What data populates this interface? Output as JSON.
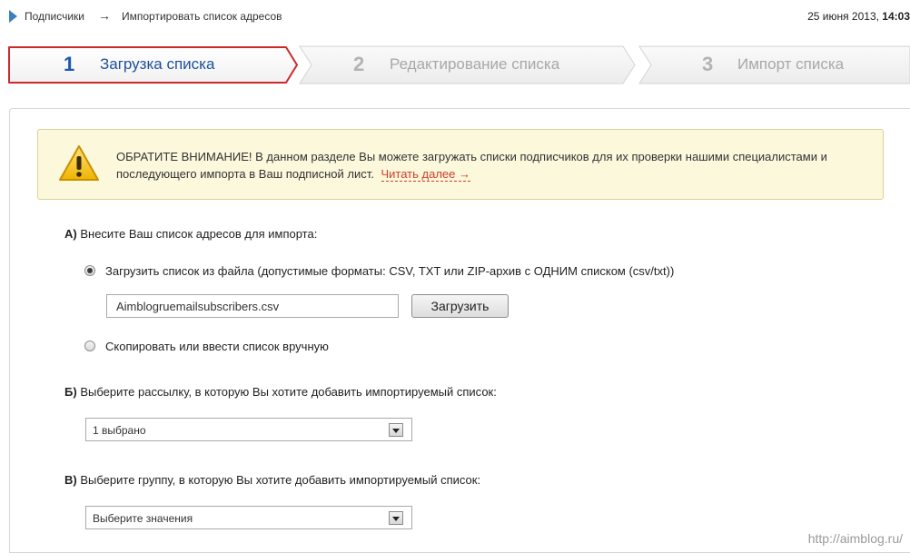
{
  "breadcrumb": {
    "item1": "Подписчики",
    "separator": "→",
    "item2": "Импортировать список адресов"
  },
  "datetime": {
    "date": "25 июня 2013,",
    "time": "14:03"
  },
  "steps": [
    {
      "num": "1",
      "label": "Загрузка списка",
      "active": true
    },
    {
      "num": "2",
      "label": "Редактирование списка",
      "active": false
    },
    {
      "num": "3",
      "label": "Импорт списка",
      "active": false
    }
  ],
  "notice": {
    "text": "ОБРАТИТЕ ВНИМАНИЕ! В данном разделе Вы можете загружать списки подписчиков для их проверки нашими специалистами и последующего импорта в Ваш подписной лист.",
    "link": "Читать далее →"
  },
  "sectionA": {
    "letter": "А)",
    "label": "Внесите Ваш список адресов для импорта:",
    "option_file": "Загрузить список из файла (допустимые форматы: CSV, TXT или ZIP-архив с ОДНИМ списком (csv/txt))",
    "file_value": "Aimblogruemailsubscribers.csv",
    "upload_button": "Загрузить",
    "option_manual": "Скопировать или ввести список вручную"
  },
  "sectionB": {
    "letter": "Б)",
    "label": "Выберите рассылку, в которую Вы хотите добавить импортируемый список:",
    "select_value": "1 выбрано"
  },
  "sectionC": {
    "letter": "В)",
    "label": "Выберите группу, в которую Вы хотите добавить импортируемый список:",
    "select_value": "Выберите значения"
  },
  "watermark": "http://aimblog.ru/",
  "colors": {
    "accent": "#1e58b4",
    "active_border": "#cc2a2a",
    "link": "#d23b2a",
    "notice_bg": "#fcf8dc"
  }
}
